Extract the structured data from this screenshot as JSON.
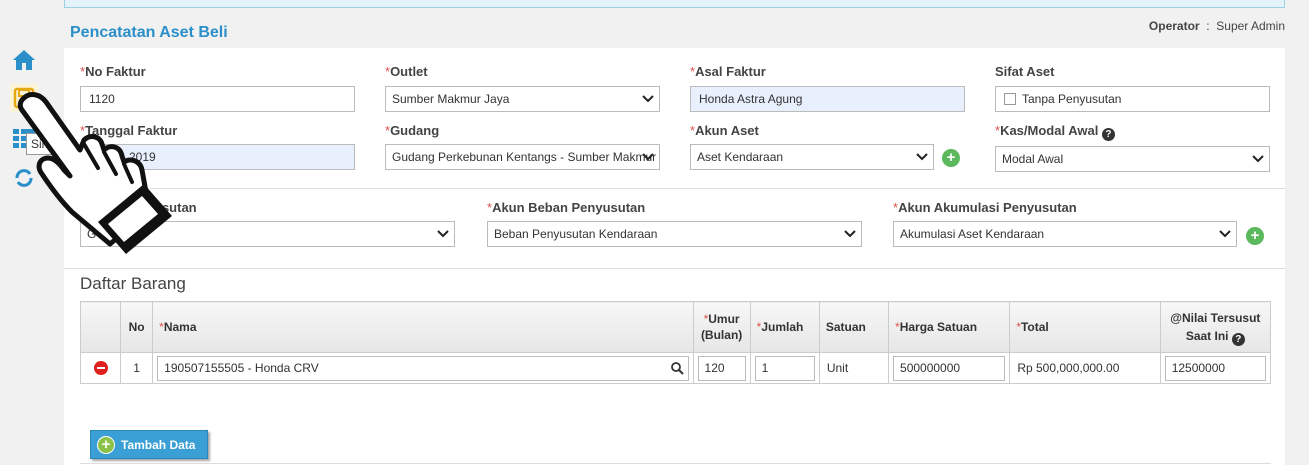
{
  "page": {
    "title": "Pencatatan Aset Beli",
    "operator_label": "Operator",
    "operator_sep": ":",
    "operator_name": "Super Admin"
  },
  "sidebar": {
    "items": [
      {
        "icon": "home-icon"
      },
      {
        "icon": "save-icon"
      },
      {
        "icon": "list-icon"
      },
      {
        "icon": "refresh-icon"
      }
    ],
    "tooltip": "Simpan"
  },
  "form": {
    "required_mark": "*",
    "no_faktur": {
      "label": "No Faktur",
      "value": "1120"
    },
    "outlet": {
      "label": "Outlet",
      "value": "Sumber Makmur Jaya"
    },
    "asal_faktur": {
      "label": "Asal Faktur",
      "value": "Honda Astra Agung"
    },
    "sifat_aset": {
      "label": "Sifat Aset",
      "checkbox_label": "Tanpa Penyusutan"
    },
    "tanggal_faktur": {
      "label": "Tanggal Faktur",
      "label_visible": "anggal Faktur",
      "value": "2019"
    },
    "gudang": {
      "label": "Gudang",
      "value": "Gudang Perkebunan Kentangs - Sumber Makmur"
    },
    "akun_aset": {
      "label": "Akun Aset",
      "value": "Aset Kendaraan"
    },
    "kas_modal_awal": {
      "label": "Kas/Modal Awal",
      "value": "Modal Awal"
    },
    "metode_penyusutan": {
      "label_visible": "usutan",
      "value": "G"
    },
    "akun_beban": {
      "label": "Akun Beban Penyusutan",
      "value": "Beban Penyusutan Kendaraan"
    },
    "akun_akumulasi": {
      "label": "Akun Akumulasi Penyusutan",
      "value": "Akumulasi Aset Kendaraan"
    }
  },
  "daftar_barang": {
    "title": "Daftar Barang",
    "columns": {
      "no": "No",
      "nama": "Nama",
      "umur_line1": "Umur",
      "umur_line2": "(Bulan)",
      "jumlah": "Jumlah",
      "satuan": "Satuan",
      "harga_satuan": "Harga Satuan",
      "total": "Total",
      "nilai_line1": "@Nilai Tersusut",
      "nilai_line2": "Saat Ini"
    },
    "rows": [
      {
        "no": "1",
        "nama": "190507155505 - Honda CRV",
        "umur": "120",
        "jumlah": "1",
        "satuan": "Unit",
        "harga_satuan": "500000000",
        "total": "Rp 500,000,000.00",
        "nilai": "12500000"
      }
    ],
    "add_button": "Tambah Data"
  },
  "colors": {
    "accent": "#2b8fc9",
    "required": "#d9534f",
    "add_green": "#5cb85c",
    "delete_red": "#e0201e",
    "button_blue": "#3a9fd5"
  }
}
